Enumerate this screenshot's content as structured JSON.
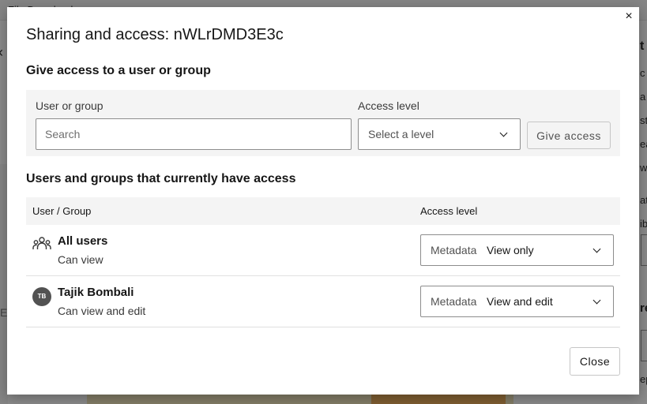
{
  "background": {
    "topbar_text": "File    Download",
    "left_letter": "E",
    "right_letters": [
      "t",
      "c",
      "a",
      "st",
      "ea",
      "w",
      "at",
      "ib",
      "re",
      "ep"
    ]
  },
  "modal": {
    "close_icon": "×",
    "title": "Sharing and access: nWLrDMD3E3c",
    "give_access_section": {
      "title": "Give access to a user or group",
      "user_label": "User or group",
      "search_placeholder": "Search",
      "search_value": "",
      "level_label": "Access level",
      "level_placeholder": "Select a level",
      "give_button": "Give access"
    },
    "current_access_section": {
      "title": "Users and groups that currently have access",
      "headers": [
        "User / Group",
        "Access level"
      ],
      "rows": [
        {
          "icon": "user-group-icon",
          "name": "All users",
          "permission": "Can view",
          "metadata_label": "Metadata",
          "access_value": "View only"
        },
        {
          "icon": "avatar",
          "initials": "TB",
          "name": "Tajik Bombali",
          "permission": "Can view and edit",
          "metadata_label": "Metadata",
          "access_value": "View and edit"
        }
      ]
    },
    "close_button": "Close"
  },
  "colors": {
    "scrim": "#161616",
    "panel_gray": "#f4f4f4",
    "text_primary": "#161616",
    "avatar_bg": "#525252"
  }
}
